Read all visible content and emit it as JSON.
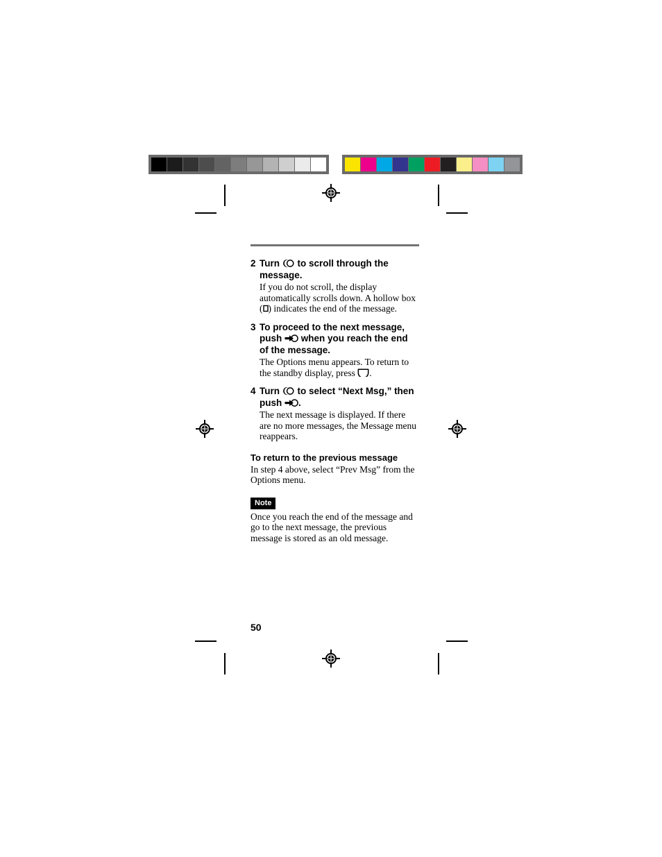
{
  "document": {
    "page_number": "50",
    "folio_label": "50"
  },
  "calibration": {
    "grayscale_bar": {
      "name": "grayscale-step-wedge",
      "frame_color": "#6b6b6b",
      "patches": [
        "#000000",
        "#1c1c1c",
        "#333333",
        "#4d4d4d",
        "#636363",
        "#7d7d7d",
        "#979797",
        "#b3b3b3",
        "#cfcfcf",
        "#ebebeb",
        "#ffffff"
      ]
    },
    "color_bar": {
      "name": "color-control-bar",
      "frame_color": "#6b6b6b",
      "patches": [
        "#fbe500",
        "#ec008c",
        "#00a8e6",
        "#33348e",
        "#00a160",
        "#ed1c24",
        "#231f20",
        "#fbef8b",
        "#f58ec3",
        "#7fd3f2",
        "#939598"
      ]
    }
  },
  "marks": {
    "registration_target_name": "registration-target",
    "crop_mark_name": "crop-mark"
  },
  "content": {
    "steps": [
      {
        "number": "2",
        "head_before": "Turn",
        "head_icon": "jog-dial-turn-icon",
        "head_after": "to scroll through the message.",
        "desc_1": "If you do not scroll, the display automatically scrolls down. A hollow box (",
        "desc_icon": "hollow-box-icon",
        "desc_2": ") indicates the end of the message."
      },
      {
        "number": "3",
        "head_before": "To proceed to the next message, push",
        "head_icon": "jog-dial-push-icon",
        "head_after": "when you reach the end of the message.",
        "desc_1": "The Options menu appears. To return to the standby display, press",
        "desc_icon": "standby-key-icon",
        "desc_2": "."
      },
      {
        "number": "4",
        "head_before": "Turn",
        "head_icon": "jog-dial-turn-icon",
        "head_mid": "to select “Next Msg,” then push",
        "head_icon_2": "jog-dial-push-icon",
        "head_after": ".",
        "desc_1": "The next message is displayed. If there are no more messages, the Message menu reappears."
      }
    ],
    "section": {
      "heading": "To return to the previous message",
      "body": "In step 4 above, select “Prev Msg” from the Options menu."
    },
    "note": {
      "badge": "Note",
      "body": "Once you reach the end of the message and go to the next message, the previous message is stored as an old message."
    }
  }
}
